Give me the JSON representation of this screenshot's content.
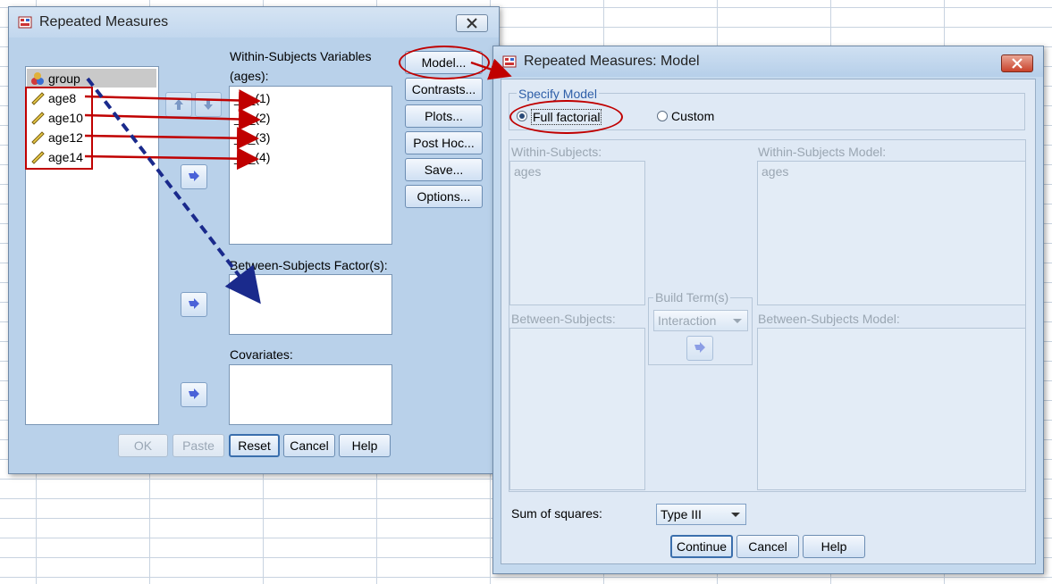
{
  "main_dialog": {
    "title": "Repeated Measures",
    "source_vars": [
      {
        "name": "group",
        "icon": "nominal-icon"
      },
      {
        "name": "age8",
        "icon": "scale-icon"
      },
      {
        "name": "age10",
        "icon": "scale-icon"
      },
      {
        "name": "age12",
        "icon": "scale-icon"
      },
      {
        "name": "age14",
        "icon": "scale-icon"
      }
    ],
    "within_label": "Within-Subjects Variables",
    "within_sub": "(ages):",
    "within_slots": [
      "_?_(1)",
      "_?_(2)",
      "_?_(3)",
      "_?_(4)"
    ],
    "between_label": "Between-Subjects Factor(s):",
    "covariates_label": "Covariates:",
    "side_buttons": [
      "Model...",
      "Contrasts...",
      "Plots...",
      "Post Hoc...",
      "Save...",
      "Options..."
    ],
    "bottom_buttons": [
      "OK",
      "Paste",
      "Reset",
      "Cancel",
      "Help"
    ]
  },
  "model_dialog": {
    "title": "Repeated Measures: Model",
    "specify_label": "Specify Model",
    "full_factorial": "Full factorial",
    "custom": "Custom",
    "within_subjects_label": "Within-Subjects:",
    "within_subjects_item": "ages",
    "within_model_label": "Within-Subjects Model:",
    "within_model_item": "ages",
    "build_terms_label": "Build Term(s)",
    "build_terms_value": "Interaction",
    "between_subjects_label": "Between-Subjects:",
    "between_model_label": "Between-Subjects Model:",
    "sum_squares_label": "Sum of squares:",
    "sum_squares_value": "Type III",
    "buttons": [
      "Continue",
      "Cancel",
      "Help"
    ]
  },
  "colors": {
    "annotation_red": "#c00000",
    "annotation_blue": "#1a2a8c"
  }
}
